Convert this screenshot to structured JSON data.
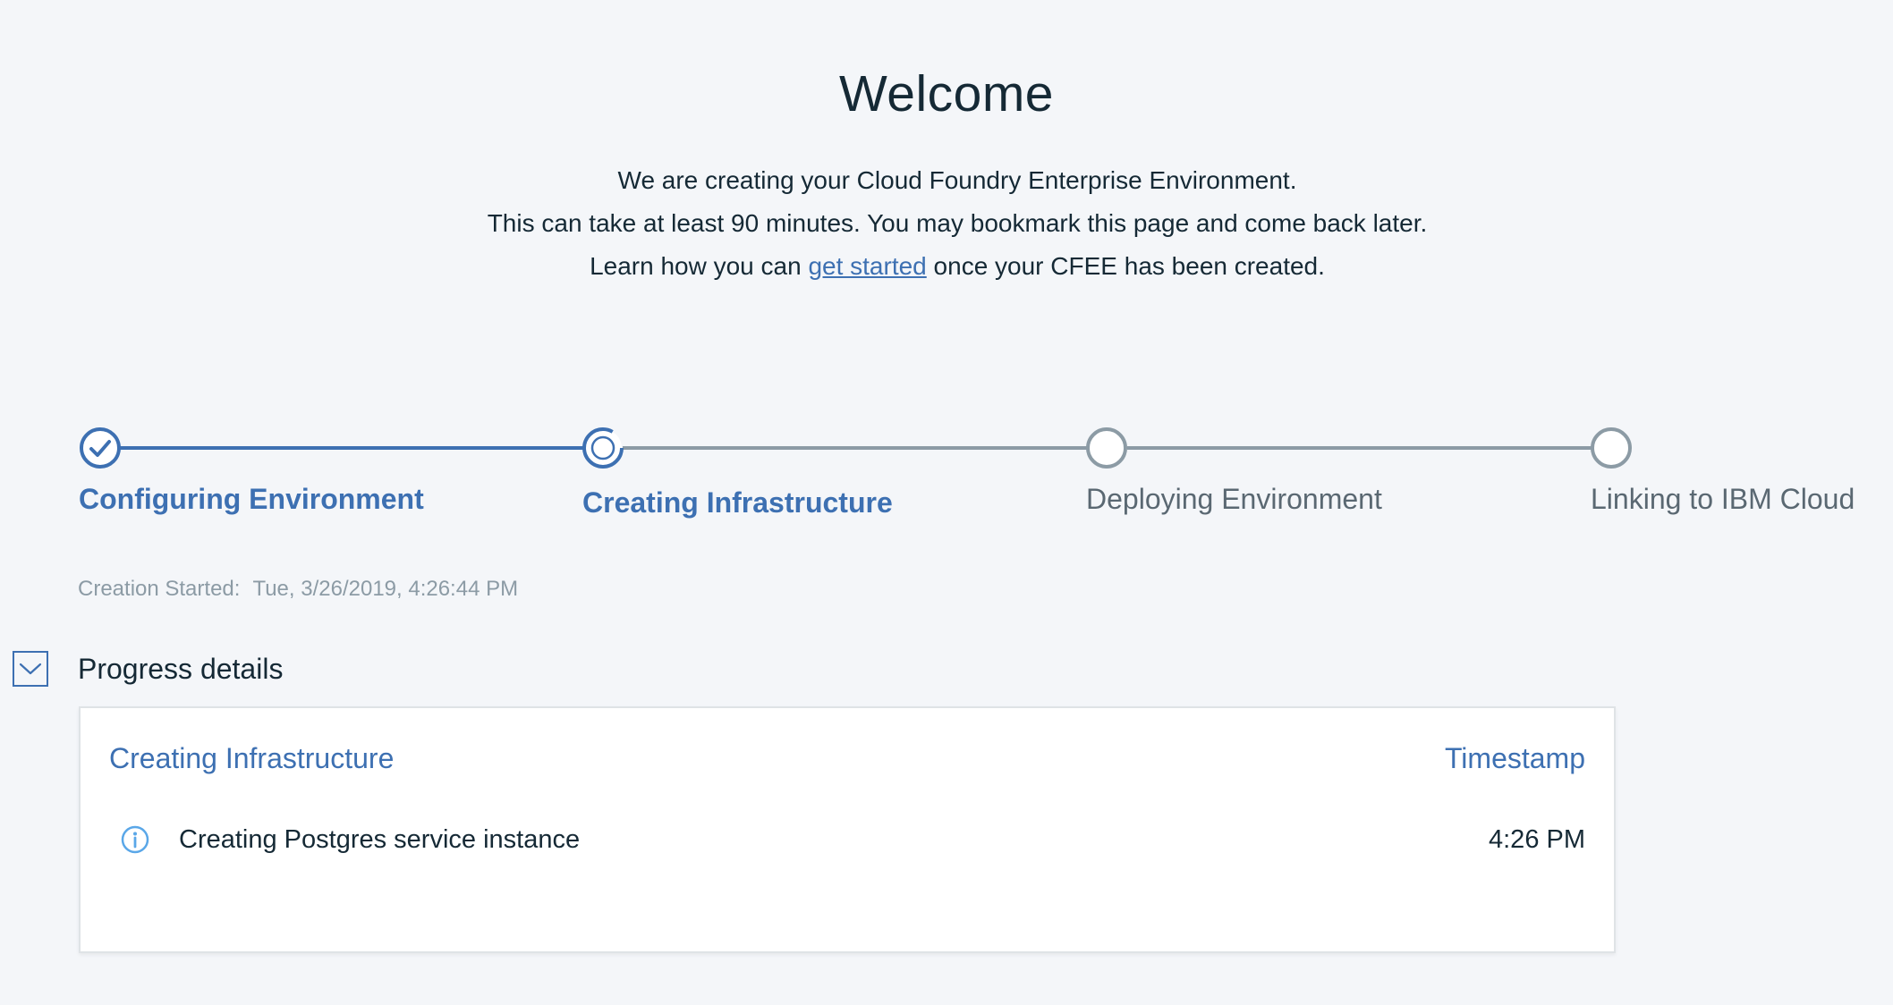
{
  "header": {
    "title": "Welcome",
    "line1": "We are creating your Cloud Foundry Enterprise Environment.",
    "line2": "This can take at least 90 minutes. You may bookmark this page and come back later.",
    "line3_before": "Learn how you can ",
    "line3_link": "get started",
    "line3_after": " once your CFEE has been created."
  },
  "progress": {
    "steps": [
      {
        "label": "Configuring Environment",
        "status": "complete"
      },
      {
        "label": "Creating Infrastructure",
        "status": "in-progress"
      },
      {
        "label": "Deploying Environment",
        "status": "pending"
      },
      {
        "label": "Linking to IBM Cloud",
        "status": "pending"
      }
    ]
  },
  "creation": {
    "label": "Creation Started:",
    "value": "Tue, 3/26/2019, 4:26:44 PM"
  },
  "details": {
    "title": "Progress details",
    "toggle_icon": "chevron-down-icon",
    "card": {
      "stage": "Creating Infrastructure",
      "timestamp_header": "Timestamp",
      "rows": [
        {
          "icon": "info-icon",
          "message": "Creating Postgres service instance",
          "time": "4:26 PM"
        }
      ]
    }
  },
  "colors": {
    "accent": "#3d70b2",
    "pending": "#8c9ba5",
    "background": "#f4f6f9",
    "info": "#5aa7e8"
  }
}
